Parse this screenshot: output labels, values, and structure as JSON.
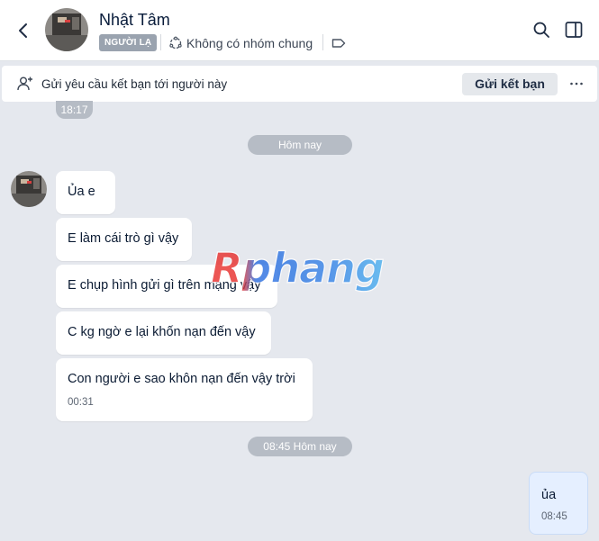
{
  "header": {
    "contact_name": "Nhật Tâm",
    "stranger_badge": "NGƯỜI LẠ",
    "no_common_group": "Không có nhóm chung",
    "icons": [
      "back-arrow-icon",
      "avatar",
      "group-circle-icon",
      "tag-icon",
      "search-icon",
      "side-panel-icon"
    ]
  },
  "friend_request_bar": {
    "text": "Gửi yêu cầu kết bạn tới người này",
    "button_label": "Gửi kết bạn",
    "more_label": "···"
  },
  "time_dividers": {
    "partial_time": "18:17",
    "today": "Hôm nay",
    "later_today": "08:45 Hôm nay"
  },
  "messages_incoming": [
    {
      "text": "Ủa e"
    },
    {
      "text": "E làm cái trò gì vậy"
    },
    {
      "text": "E chụp hình gửi gì trên mạng vậy"
    },
    {
      "text": "C kg ngờ e lại khốn nạn đến vậy"
    },
    {
      "text": "Con người e sao khôn nạn đến vậy trời",
      "time": "00:31"
    }
  ],
  "messages_outgoing": [
    {
      "text": "ủa",
      "time": "08:45"
    }
  ],
  "watermark": "Rphang",
  "colors": {
    "background": "#e5e8ee",
    "incoming_bubble": "#ffffff",
    "outgoing_bubble": "#e5efff",
    "chip": "#b6bcc5",
    "badge": "#9aa3af"
  }
}
